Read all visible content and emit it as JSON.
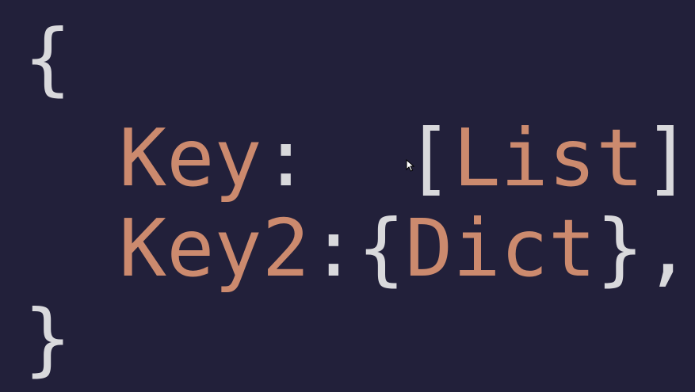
{
  "code": {
    "open_brace": "{",
    "lines": [
      {
        "key": "Key",
        "sep": ":  ",
        "open": "[",
        "value": "List",
        "close": "]",
        "trail": ","
      },
      {
        "key": "Key2",
        "sep": ":",
        "open": "{",
        "value": "Dict",
        "close": "}",
        "trail": ","
      }
    ],
    "close_brace": "}"
  },
  "colors": {
    "background": "#22203a",
    "punctuation": "#d9d9dc",
    "key": "#cc8a6e"
  },
  "icons": {
    "cursor": "mouse-pointer-icon"
  }
}
